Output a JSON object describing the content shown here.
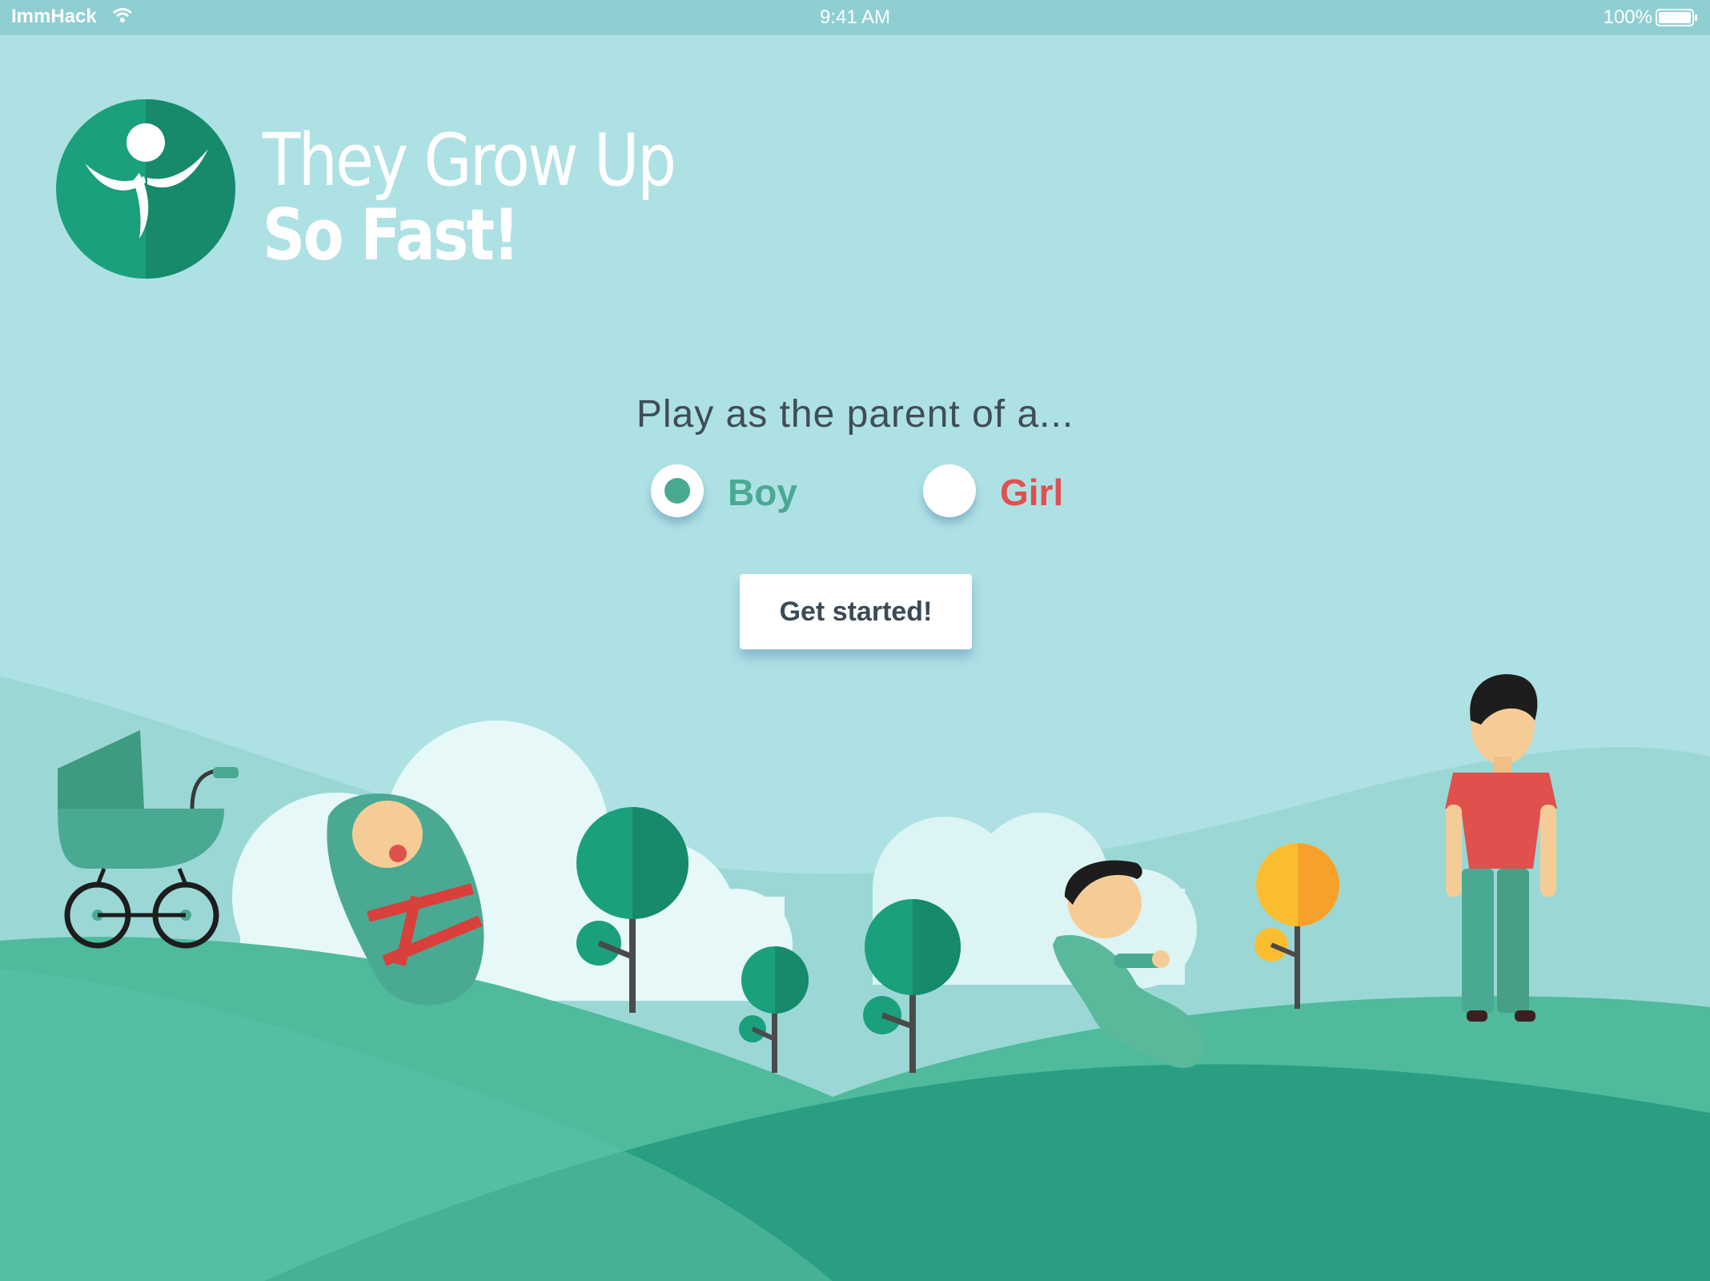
{
  "status_bar": {
    "carrier": "ImmHack",
    "time": "9:41 AM",
    "battery": "100%"
  },
  "app": {
    "title_line1": "They Grow Up",
    "title_line2": "So Fast!"
  },
  "setup": {
    "prompt": "Play as the parent of a...",
    "options": [
      {
        "label": "Boy",
        "selected": true,
        "color": "#4aa993"
      },
      {
        "label": "Girl",
        "selected": false,
        "color": "#e0504c"
      }
    ],
    "start_label": "Get started!"
  },
  "icons": {
    "wifi": "wifi-icon",
    "battery": "battery-icon",
    "logo": "logo-icon"
  },
  "colors": {
    "sky": "#aee1e4",
    "status_bar": "#90cfd1",
    "hill_dark": "#2a9e82",
    "hill_mid": "#4fba9c",
    "accent_green": "#4aa993",
    "accent_red": "#e0504c"
  }
}
